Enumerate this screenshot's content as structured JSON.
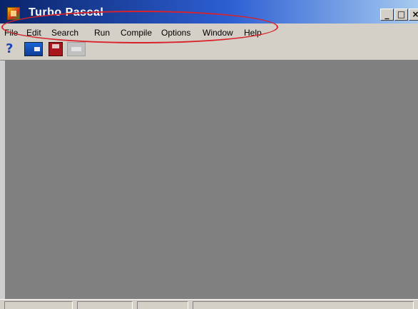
{
  "window": {
    "title": "Turbo Pascal",
    "controls": {
      "minimize": "_",
      "maximize": "□",
      "close": "×"
    }
  },
  "menubar": {
    "items": [
      "File",
      "Edit",
      "Search",
      "Run",
      "Compile",
      "Options",
      "Window",
      "Help"
    ],
    "annotation_color": "#d8232a"
  },
  "toolbar": {
    "help_glyph": "?",
    "buttons": [
      "help-icon",
      "open-file-icon",
      "save-icon",
      "disabled-tool-icon"
    ]
  },
  "colors": {
    "title_gradient_start": "#0a246a",
    "workspace": "#808080",
    "chrome": "#d4d0c8"
  }
}
